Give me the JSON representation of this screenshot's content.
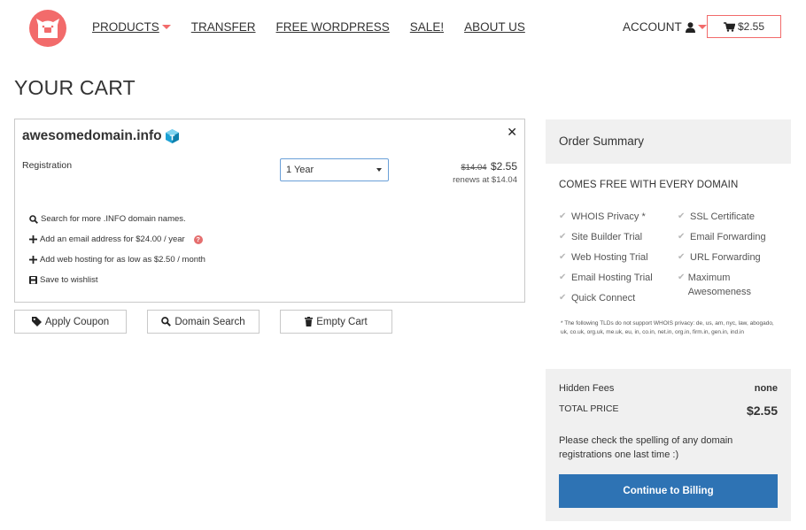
{
  "header": {
    "nav": [
      {
        "label": "PRODUCTS",
        "has_caret": true
      },
      {
        "label": "TRANSFER"
      },
      {
        "label": "FREE WORDPRESS"
      },
      {
        "label": "SALE!"
      },
      {
        "label": "ABOUT US"
      }
    ],
    "account_label": "ACCOUNT",
    "cart_total": "$2.55"
  },
  "page_title": "YOUR CART",
  "cart_item": {
    "domain": "awesomedomain.info",
    "registration_label": "Registration",
    "term_selected": "1 Year",
    "price_old": "$14.04",
    "price_new": "$2.55",
    "renews": "renews at $14.04",
    "options": [
      {
        "icon": "search-icon",
        "label": "Search for more .INFO domain names."
      },
      {
        "icon": "plus-icon",
        "label": "Add an email address for $24.00 / year"
      },
      {
        "icon": "plus-icon",
        "label": "Add web hosting for as low as $2.50 / month"
      },
      {
        "icon": "save-icon",
        "label": "Save to wishlist"
      }
    ]
  },
  "actions": {
    "apply_coupon": "Apply Coupon",
    "domain_search": "Domain Search",
    "empty_cart": "Empty Cart"
  },
  "summary": {
    "title": "Order Summary",
    "free_title": "COMES FREE WITH EVERY DOMAIN",
    "features_left": [
      "WHOIS Privacy *",
      "Site Builder Trial",
      "Web Hosting Trial",
      "Email Hosting Trial",
      "Quick Connect"
    ],
    "features_right": [
      "SSL Certificate",
      "Email Forwarding",
      "URL Forwarding",
      "Maximum Awesomeness"
    ],
    "footnote": "* The following TLDs do not support WHOIS privacy: de, us, am, nyc, law, abogado, uk, co.uk, org.uk, me.uk, eu, in, co.in, net.in, org.in, firm.in, gen.in, ind.in",
    "hidden_fees_label": "Hidden Fees",
    "hidden_fees_value": "none",
    "total_label": "TOTAL PRICE",
    "total_value": "$2.55",
    "note": "Please check the spelling of any domain registrations one last time :)",
    "continue_label": "Continue to Billing"
  },
  "colors": {
    "accent": "#f26b6b",
    "primary": "#2e73b4",
    "panel": "#f0f0f0"
  }
}
